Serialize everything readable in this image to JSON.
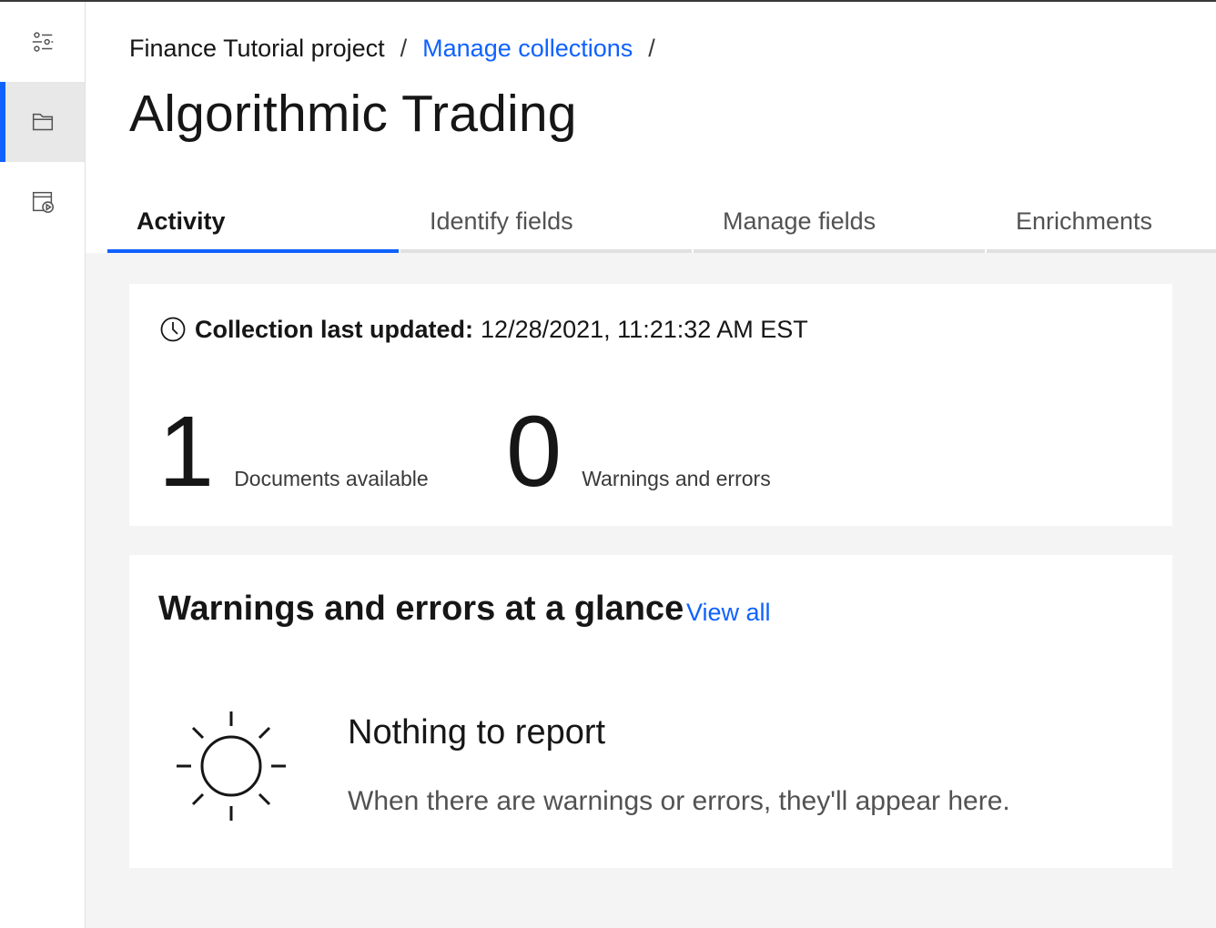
{
  "rail": {
    "items": [
      {
        "icon": "settings-sliders-icon"
      },
      {
        "icon": "folder-icon",
        "active": true
      },
      {
        "icon": "calendar-play-icon"
      }
    ]
  },
  "breadcrumb": {
    "project": "Finance Tutorial project",
    "separator": "/",
    "collections": "Manage collections"
  },
  "page_title": "Algorithmic Trading",
  "tabs": [
    {
      "label": "Activity",
      "active": true
    },
    {
      "label": "Identify fields"
    },
    {
      "label": "Manage fields"
    },
    {
      "label": "Enrichments"
    }
  ],
  "activity": {
    "updated_label": "Collection last updated:",
    "updated_value": "12/28/2021, 11:21:32 AM EST",
    "documents_count": "1",
    "documents_label": "Documents available",
    "warnings_count": "0",
    "warnings_label": "Warnings and errors"
  },
  "glance": {
    "title": "Warnings and errors at a glance",
    "view_all": "View all",
    "empty_title": "Nothing to report",
    "empty_desc": "When there are warnings or errors, they'll appear here."
  },
  "colors": {
    "accent": "#0f62fe",
    "background": "#f4f4f4",
    "card": "#ffffff"
  }
}
